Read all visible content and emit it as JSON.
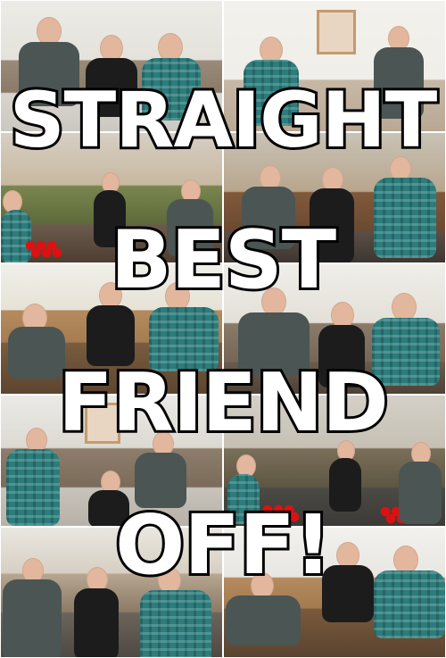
{
  "poster": {
    "title_lines": [
      "STRAIGHT",
      "BEST",
      "FRIEND",
      "OFF!"
    ]
  },
  "colors": {
    "text_fill": "#ffffff",
    "text_outline": "#000000",
    "cups": "#dd1111"
  },
  "icons": {
    "cups": "red-cups-icon",
    "portrait": "framed-portrait-icon"
  }
}
